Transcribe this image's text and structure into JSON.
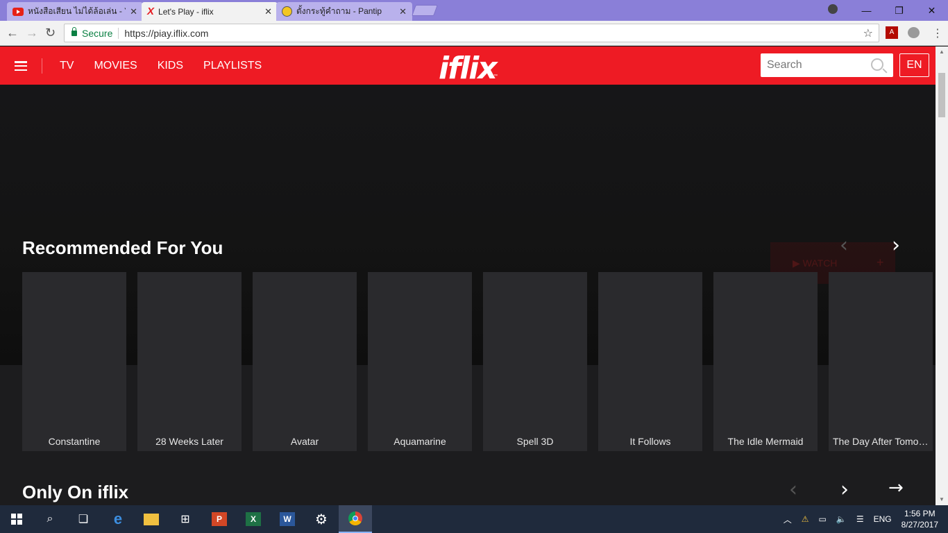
{
  "browser": {
    "tabs": [
      {
        "title": "หนังสือเสียน ไม่ได้ล้อเล่น - Yo",
        "icon": "youtube-icon"
      },
      {
        "title": "Let's Play - iflix",
        "icon": "iflix-icon"
      },
      {
        "title": "ตั้งกระทู้คำถาม - Pantip",
        "icon": "pantip-icon"
      }
    ],
    "close_glyph": "✕",
    "secure_label": "Secure",
    "url": "https://piay.iflix.com",
    "window_controls": [
      "—",
      "❐",
      "✕"
    ]
  },
  "header": {
    "nav": [
      "TV",
      "MOVIES",
      "KIDS",
      "PLAYLISTS"
    ],
    "logo": "iflix",
    "logo_tm": "™",
    "search_placeholder": "Search",
    "language": "EN"
  },
  "hero": {
    "watch_label": "▶ WATCH",
    "add_label": "+"
  },
  "sections": [
    {
      "title": "Recommended For You",
      "items": [
        "Constantine",
        "28 Weeks Later",
        "Avatar",
        "Aquamarine",
        "Spell 3D",
        "It Follows",
        "The Idle Mermaid",
        "The Day After Tomorrow"
      ]
    },
    {
      "title": "Only On iflix",
      "items": []
    }
  ],
  "arrows": {
    "prev": "‹",
    "next": "›",
    "forward": "→"
  },
  "taskbar": {
    "powerpoint": "P",
    "excel": "X",
    "word": "W",
    "tray_language": "ENG",
    "time": "1:56 PM",
    "date": "8/27/2017"
  },
  "colors": {
    "brand_red": "#ee1b24",
    "background": "#141414",
    "card": "#2a2a2d",
    "secure_green": "#0b8043"
  }
}
